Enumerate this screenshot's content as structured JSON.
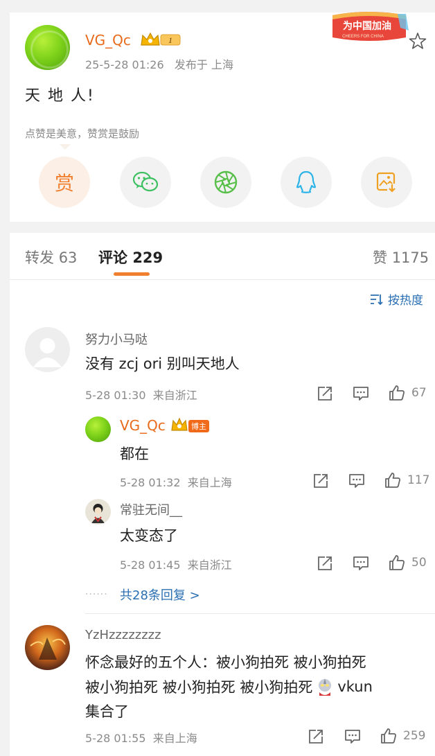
{
  "post": {
    "author": "VG_Qc",
    "level_badge": "1",
    "time": "25-5-28 01:26",
    "location": "发布于 上海",
    "text": "天 地 人!",
    "reward_hint": "点赞是美意，赞赏是鼓励",
    "reward_label": "赏",
    "badge_main": "为中国加油",
    "badge_sub": "CHEERS FOR CHINA"
  },
  "share_buttons": [
    {
      "icon": "reward-icon"
    },
    {
      "icon": "wechat-icon"
    },
    {
      "icon": "moments-icon"
    },
    {
      "icon": "qq-icon"
    },
    {
      "icon": "save-image-icon"
    }
  ],
  "tabs": {
    "repost_label": "转发",
    "repost_count": "63",
    "comment_label": "评论",
    "comment_count": "229",
    "like_label": "赞",
    "like_count": "1175"
  },
  "sort": {
    "label": "按热度"
  },
  "comments": [
    {
      "name": "努力小马哒",
      "text": "没有 zcj ori 别叫天地人",
      "time": "5-28 01:30",
      "from": "来自浙江",
      "likes": "67",
      "replies": [
        {
          "name": "VG_Qc",
          "tag": "博主",
          "text": "都在",
          "time": "5-28 01:32",
          "from": "来自上海",
          "likes": "117"
        },
        {
          "name": "常驻无间__",
          "text": "太变态了",
          "time": "5-28 01:45",
          "from": "来自浙江",
          "likes": "50"
        }
      ],
      "more_replies": "共28条回复 >"
    },
    {
      "name": "YzHzzzzzzzz",
      "text_line1": "怀念最好的五个人：被小狗拍死 被小狗拍死",
      "text_line2a": "被小狗拍死 被小狗拍死 被小狗拍死",
      "text_line2b": "vkun",
      "text_line3": "集合了",
      "time": "5-28 01:55",
      "from": "来自上海",
      "likes": "259"
    }
  ],
  "colors": {
    "accent": "#f08030",
    "link": "#2a6fb3",
    "username": "#e86a1a"
  }
}
